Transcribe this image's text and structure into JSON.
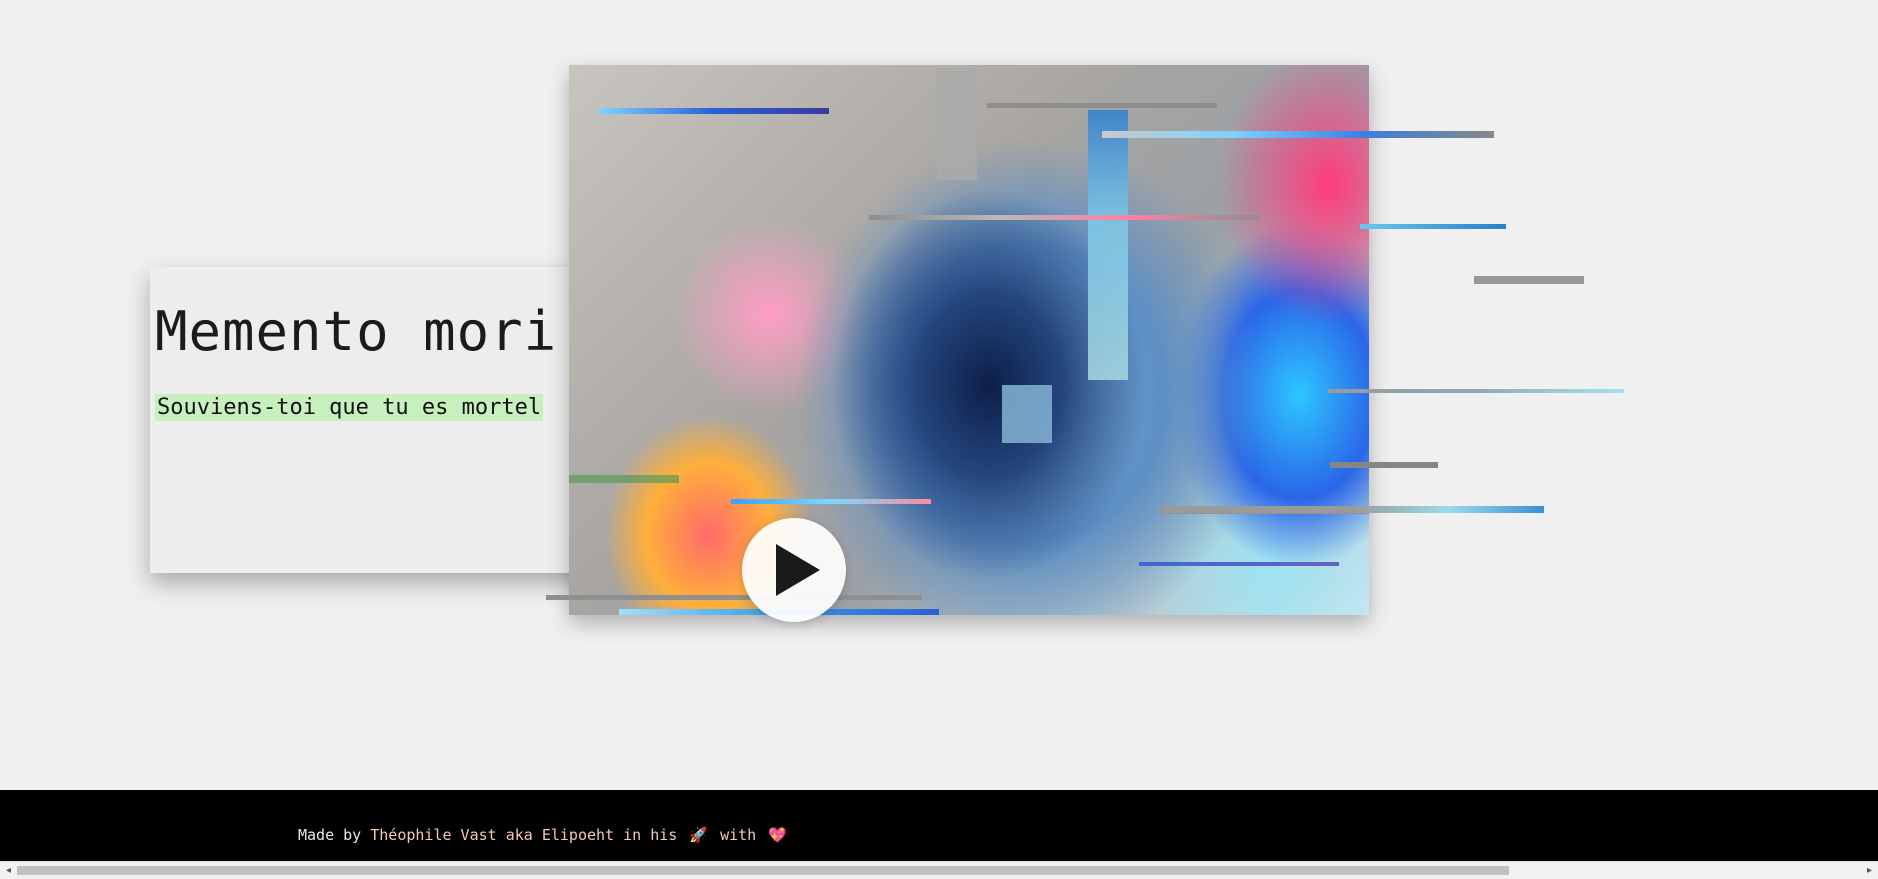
{
  "hero": {
    "title": "Memento mori",
    "subtitle": "Souviens-toi que tu es mortel"
  },
  "artwork": {
    "icon": "lion-glitch-artwork"
  },
  "play_button": {
    "icon": "play-icon"
  },
  "footer": {
    "made_by": "Made by",
    "author": "Théophile Vast aka Elipoeht",
    "in_his": "in his",
    "rocket": "🚀",
    "with": "with",
    "heart": "💖"
  },
  "scrollbar": {
    "left_arrow": "◂",
    "right_arrow": "▸"
  },
  "colors": {
    "background": "#f0f0f0",
    "highlight": "#c8f0bf",
    "footer": "#000000",
    "footer_link": "#f5c9b8"
  }
}
